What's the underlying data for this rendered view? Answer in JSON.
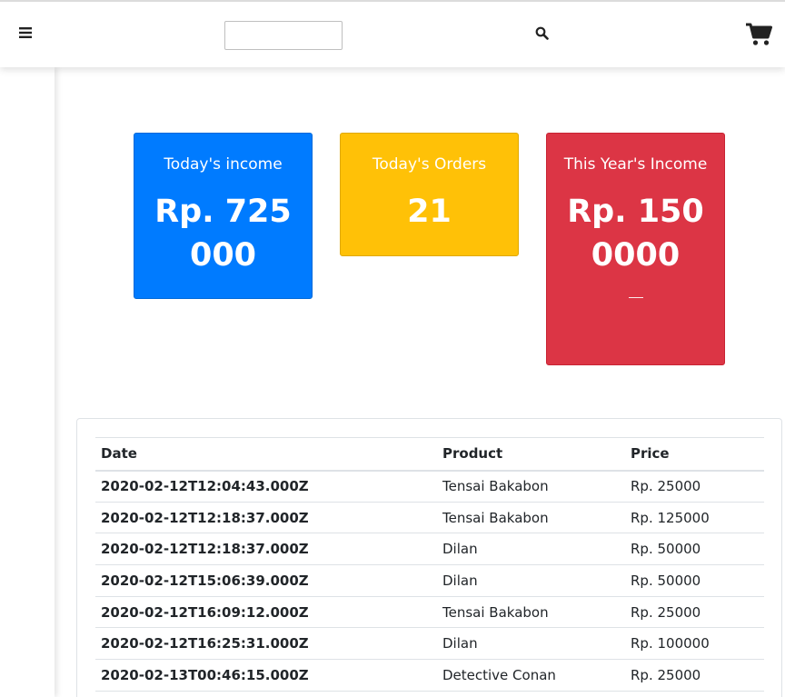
{
  "header": {
    "search_placeholder": "",
    "search_value": "",
    "menu_icon": "bars-icon",
    "search_icon": "search-icon",
    "cart_icon": "shopping-cart-icon"
  },
  "cards": {
    "today_income": {
      "title": "Today's income",
      "value": "Rp. 725000",
      "color": "#007bff"
    },
    "today_orders": {
      "title": "Today's Orders",
      "value": "21",
      "color": "#ffc107"
    },
    "year_income": {
      "title": "This Year's Income",
      "value": "Rp. 1500000",
      "color": "#dc3545"
    }
  },
  "table": {
    "headers": {
      "date": "Date",
      "product": "Product",
      "price": "Price"
    },
    "rows": [
      {
        "date": "2020-02-12T12:04:43.000Z",
        "product": "Tensai Bakabon",
        "price": "Rp. 25000"
      },
      {
        "date": "2020-02-12T12:18:37.000Z",
        "product": "Tensai Bakabon",
        "price": "Rp. 125000"
      },
      {
        "date": "2020-02-12T12:18:37.000Z",
        "product": "Dilan",
        "price": "Rp. 50000"
      },
      {
        "date": "2020-02-12T15:06:39.000Z",
        "product": "Dilan",
        "price": "Rp. 50000"
      },
      {
        "date": "2020-02-12T16:09:12.000Z",
        "product": "Tensai Bakabon",
        "price": "Rp. 25000"
      },
      {
        "date": "2020-02-12T16:25:31.000Z",
        "product": "Dilan",
        "price": "Rp. 100000"
      },
      {
        "date": "2020-02-13T00:46:15.000Z",
        "product": "Detective Conan",
        "price": "Rp. 25000"
      }
    ]
  }
}
